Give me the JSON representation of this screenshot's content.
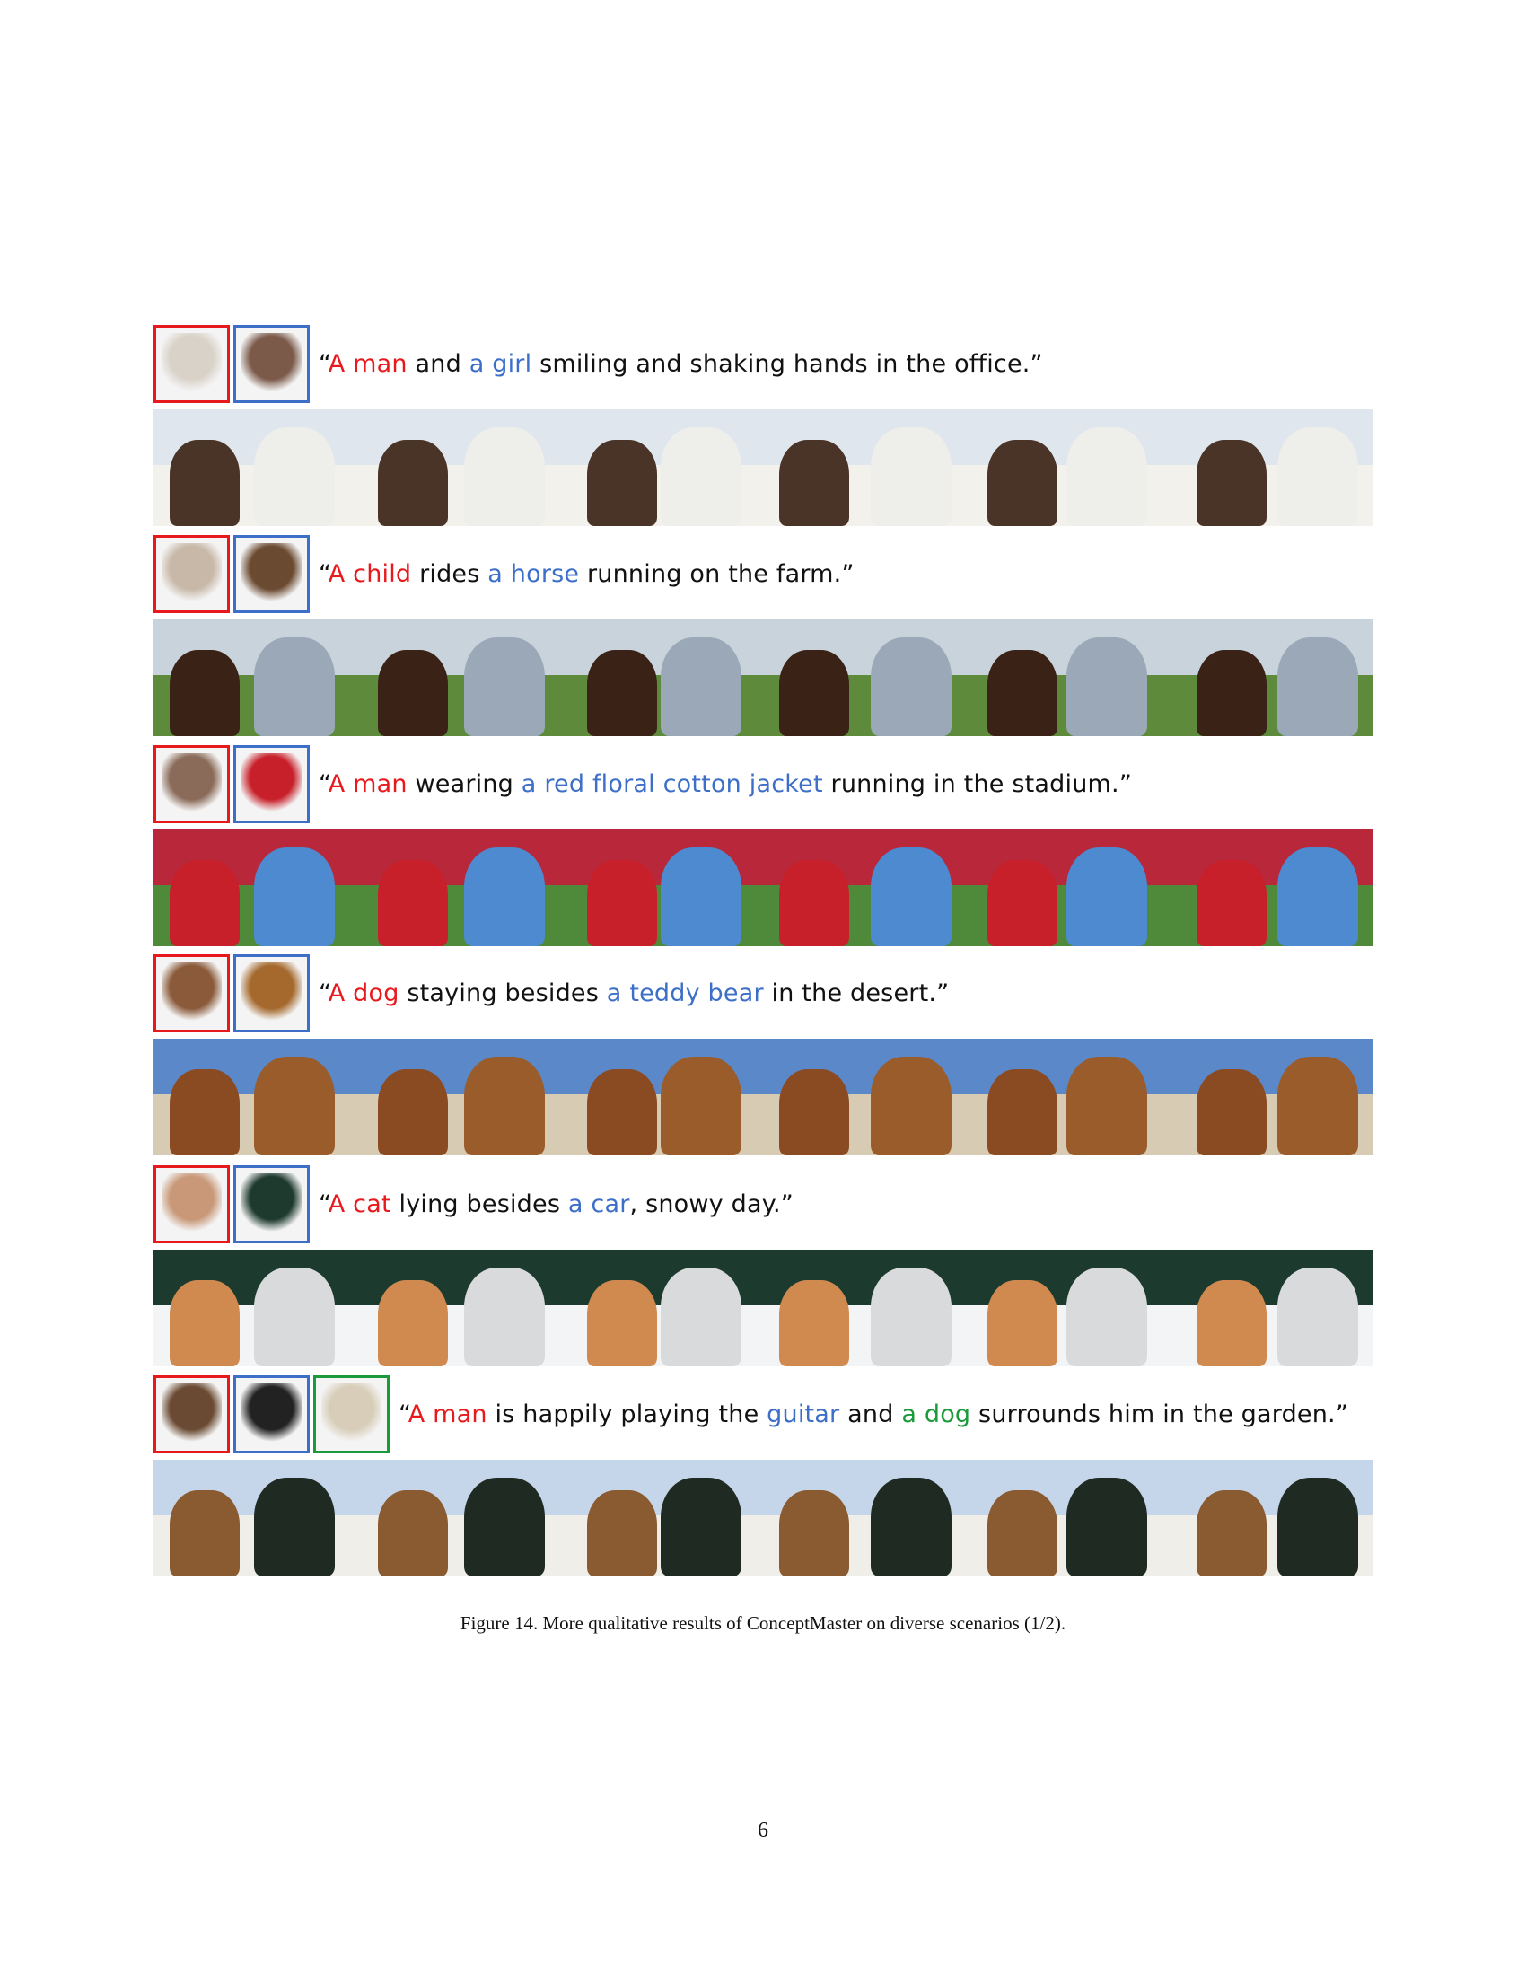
{
  "caption": "Figure 14. More qualitative results of ConceptMaster on diverse scenarios (1/2).",
  "page_number": "6",
  "colors": {
    "concept_1": "#e8191c",
    "concept_2": "#3d6fc9",
    "concept_3": "#1a9a3a",
    "text": "#111111"
  },
  "rows": [
    {
      "prompt": [
        {
          "text": "“",
          "color": "#111111"
        },
        {
          "text": "A man",
          "color": "#e8191c"
        },
        {
          "text": " and ",
          "color": "#111111"
        },
        {
          "text": "a girl",
          "color": "#3d6fc9"
        },
        {
          "text": " smiling and shaking hands in the office.”",
          "color": "#111111"
        }
      ],
      "references": [
        {
          "name": "man-reference-image",
          "border": "#e8191c",
          "fill": "#d9d2c8"
        },
        {
          "name": "girl-reference-image",
          "border": "#3d6fc9",
          "fill": "#7b5a4a"
        }
      ],
      "frames": {
        "sky": "#dfe6ee",
        "ground": "#f3f1ec",
        "a": "#4a3428",
        "b": "#eeeeea"
      }
    },
    {
      "prompt": [
        {
          "text": "“",
          "color": "#111111"
        },
        {
          "text": "A child",
          "color": "#e8191c"
        },
        {
          "text": " rides ",
          "color": "#111111"
        },
        {
          "text": "a horse",
          "color": "#3d6fc9"
        },
        {
          "text": " running on the farm.”",
          "color": "#111111"
        }
      ],
      "references": [
        {
          "name": "child-reference-image",
          "border": "#e8191c",
          "fill": "#c8b8a8"
        },
        {
          "name": "horse-reference-image",
          "border": "#3d6fc9",
          "fill": "#6b4a32"
        }
      ],
      "frames": {
        "sky": "#c9d3dc",
        "ground": "#5e8a3c",
        "a": "#3a2216",
        "b": "#9aa8b8"
      }
    },
    {
      "prompt": [
        {
          "text": "“",
          "color": "#111111"
        },
        {
          "text": "A man",
          "color": "#e8191c"
        },
        {
          "text": " wearing ",
          "color": "#111111"
        },
        {
          "text": "a red floral cotton jacket",
          "color": "#3d6fc9"
        },
        {
          "text": " running in the stadium.”",
          "color": "#111111"
        }
      ],
      "references": [
        {
          "name": "man-face-reference-image",
          "border": "#e8191c",
          "fill": "#8a6a58"
        },
        {
          "name": "red-floral-jacket-reference-image",
          "border": "#3d6fc9",
          "fill": "#c8202a"
        }
      ],
      "frames": {
        "sky": "#b8283a",
        "ground": "#4e8a3a",
        "a": "#c8202a",
        "b": "#4d8ad0"
      }
    },
    {
      "prompt": [
        {
          "text": "“",
          "color": "#111111"
        },
        {
          "text": "A dog",
          "color": "#e8191c"
        },
        {
          "text": " staying besides ",
          "color": "#111111"
        },
        {
          "text": "a teddy bear",
          "color": "#3d6fc9"
        },
        {
          "text": " in the desert.”",
          "color": "#111111"
        }
      ],
      "references": [
        {
          "name": "dog-reference-image",
          "border": "#e8191c",
          "fill": "#8a5a3a"
        },
        {
          "name": "teddy-bear-reference-image",
          "border": "#3d6fc9",
          "fill": "#a5692e"
        }
      ],
      "frames": {
        "sky": "#5a88c8",
        "ground": "#d8cbb4",
        "a": "#8a4a22",
        "b": "#9a5c2a"
      }
    },
    {
      "prompt": [
        {
          "text": "“",
          "color": "#111111"
        },
        {
          "text": "A cat",
          "color": "#e8191c"
        },
        {
          "text": " lying besides ",
          "color": "#111111"
        },
        {
          "text": "a car",
          "color": "#3d6fc9"
        },
        {
          "text": ", snowy day.”",
          "color": "#111111"
        }
      ],
      "references": [
        {
          "name": "cat-reference-image",
          "border": "#e8191c",
          "fill": "#c89878"
        },
        {
          "name": "car-reference-image",
          "border": "#3d6fc9",
          "fill": "#1e3a2e"
        }
      ],
      "frames": {
        "sky": "#1c3a2e",
        "ground": "#f3f4f6",
        "a": "#d08a50",
        "b": "#d9dadc"
      }
    },
    {
      "prompt": [
        {
          "text": "“",
          "color": "#111111"
        },
        {
          "text": "A man",
          "color": "#e8191c"
        },
        {
          "text": " is happily playing the ",
          "color": "#111111"
        },
        {
          "text": "guitar",
          "color": "#3d6fc9"
        },
        {
          "text": " and ",
          "color": "#111111"
        },
        {
          "text": "a dog",
          "color": "#1a9a3a"
        },
        {
          "text": " surrounds him in the garden.”",
          "color": "#111111"
        }
      ],
      "references": [
        {
          "name": "man-reference-image",
          "border": "#e8191c",
          "fill": "#6a4a32"
        },
        {
          "name": "guitar-reference-image",
          "border": "#3d6fc9",
          "fill": "#222222"
        },
        {
          "name": "dog-reference-image",
          "border": "#1a9a3a",
          "fill": "#d8cdb8"
        }
      ],
      "frames": {
        "sky": "#c5d6ea",
        "ground": "#efeee9",
        "a": "#8a5a30",
        "b": "#1e2a22"
      }
    }
  ]
}
